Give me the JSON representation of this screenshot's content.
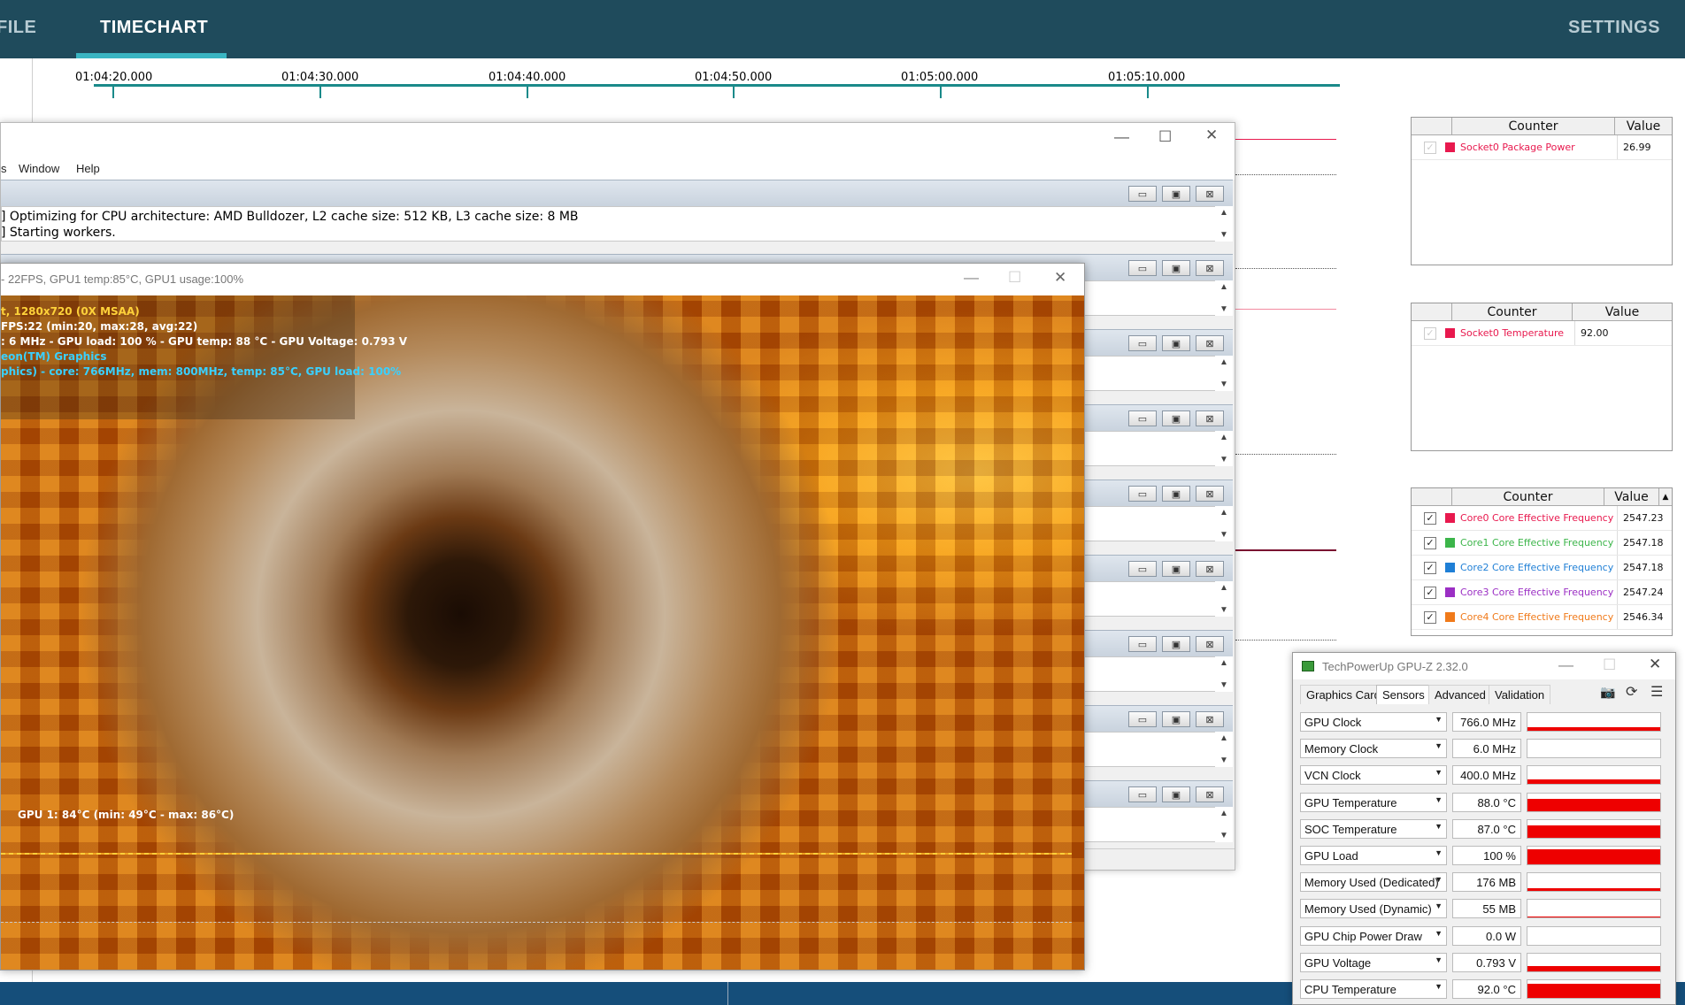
{
  "nav": {
    "profile": "FILE",
    "timechart": "TIMECHART",
    "settings": "SETTINGS"
  },
  "timeline": {
    "ticks": [
      "01:04:20.000",
      "01:04:30.000",
      "01:04:40.000",
      "01:04:50.000",
      "01:05:00.000",
      "01:05:10.000"
    ]
  },
  "tables": {
    "header_counter": "Counter",
    "header_value": "Value",
    "t1": {
      "rows": [
        {
          "name": "Socket0 Package Power",
          "value": "26.99",
          "color": "#e8194e"
        }
      ]
    },
    "t2": {
      "rows": [
        {
          "name": "Socket0 Temperature",
          "value": "92.00",
          "color": "#e8194e"
        }
      ]
    },
    "t3": {
      "rows": [
        {
          "name": "Core0 Core Effective Frequency",
          "value": "2547.23",
          "color": "#e8194e"
        },
        {
          "name": "Core1 Core Effective Frequency",
          "value": "2547.18",
          "color": "#3cb54a"
        },
        {
          "name": "Core2 Core Effective Frequency",
          "value": "2547.18",
          "color": "#1f7fd6"
        },
        {
          "name": "Core3 Core Effective Frequency",
          "value": "2547.24",
          "color": "#9b2fc4"
        },
        {
          "name": "Core4 Core Effective Frequency",
          "value": "2546.34",
          "color": "#f07a1a"
        }
      ]
    }
  },
  "back_window": {
    "menu": [
      "s",
      "Window",
      "Help"
    ],
    "log": [
      "] Optimizing for CPU architecture: AMD Bulldozer, L2 cache size: 512 KB, L3 cache size: 8 MB",
      "] Starting workers."
    ]
  },
  "render_window": {
    "title": "- 22FPS, GPU1 temp:85°C, GPU1 usage:100%",
    "overlay": [
      {
        "text": "t, 1280x720 (0X MSAA)",
        "color": "#ffd23a"
      },
      {
        "text": "FPS:22 (min:20, max:28, avg:22)",
        "color": "#ffffff"
      },
      {
        "text": ": 6 MHz - GPU load: 100 % - GPU temp: 88 °C - GPU Voltage: 0.793 V",
        "color": "#ffffff"
      },
      {
        "text": "eon(TM) Graphics",
        "color": "#3ad0ff"
      },
      {
        "text": "phics) - core: 766MHz, mem: 800MHz, temp: 85°C, GPU load: 100%",
        "color": "#3ad0ff"
      }
    ],
    "gpu_graph_label": "GPU 1: 84°C (min: 49°C - max: 86°C)"
  },
  "gpuz": {
    "title": "TechPowerUp GPU-Z 2.32.0",
    "tabs": [
      "Graphics Card",
      "Sensors",
      "Advanced",
      "Validation"
    ],
    "active_tab": "Sensors",
    "sensors": [
      {
        "name": "GPU Clock",
        "value": "766.0 MHz",
        "fill": 0.2
      },
      {
        "name": "Memory Clock",
        "value": "6.0 MHz",
        "fill": 0.02
      },
      {
        "name": "VCN Clock",
        "value": "400.0 MHz",
        "fill": 0.25
      },
      {
        "name": "GPU Temperature",
        "value": "88.0 °C",
        "fill": 0.7
      },
      {
        "name": "SOC Temperature",
        "value": "87.0 °C",
        "fill": 0.7
      },
      {
        "name": "GPU Load",
        "value": "100 %",
        "fill": 0.85
      },
      {
        "name": "Memory Used (Dedicated)",
        "value": "176 MB",
        "fill": 0.15
      },
      {
        "name": "Memory Used (Dynamic)",
        "value": "55 MB",
        "fill": 0.06
      },
      {
        "name": "GPU Chip Power Draw",
        "value": "0.0 W",
        "fill": 0.0
      },
      {
        "name": "GPU Voltage",
        "value": "0.793 V",
        "fill": 0.3
      },
      {
        "name": "CPU Temperature",
        "value": "92.0 °C",
        "fill": 0.8
      }
    ]
  },
  "colors": {
    "appbar": "#1f4b5c",
    "accent": "#3ab5c2",
    "gpuz_bar": "#ee0000"
  }
}
